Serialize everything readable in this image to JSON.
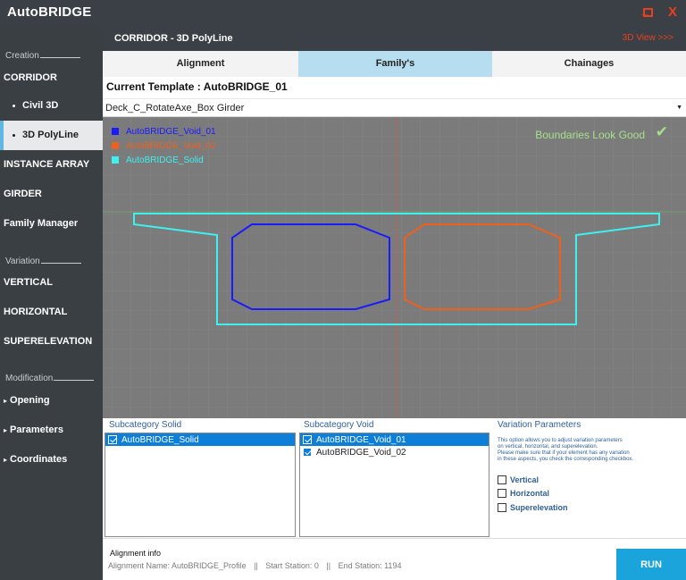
{
  "app": {
    "title": "AutoBRIDGE",
    "minimize_label": "_",
    "close_label": "X"
  },
  "sidebar": {
    "creation_label": "Creation",
    "corridor": "CORRIDOR",
    "civil3d": "Civil 3D",
    "polyline3d": "3D PolyLine",
    "instance_array": "INSTANCE ARRAY",
    "girder": "GIRDER",
    "family_manager": "Family Manager",
    "variation_label": "Variation",
    "vertical": "VERTICAL",
    "horizontal": "HORIZONTAL",
    "superelevation": "SUPERELEVATION",
    "modification_label": "Modification",
    "opening": "Opening",
    "parameters": "Parameters",
    "coordinates": "Coordinates"
  },
  "header": {
    "title": "CORRIDOR - 3D PolyLine",
    "view_link": "3D View >>>"
  },
  "tabs": [
    {
      "label": "Alignment",
      "active": false
    },
    {
      "label": "Family's",
      "active": true
    },
    {
      "label": "Chainages",
      "active": false
    }
  ],
  "template": {
    "label": "Current Template : ",
    "value": "AutoBRIDGE_01"
  },
  "family_select": {
    "value": "Deck_C_RotateAxe_Box Girder"
  },
  "canvas": {
    "legend": [
      {
        "name": "AutoBRIDGE_Void_01",
        "color": "#1a1aff"
      },
      {
        "name": "AutoBRIDGE_Void_02",
        "color": "#f0601c"
      },
      {
        "name": "AutoBRIDGE_Solid",
        "color": "#3ff0f0"
      }
    ],
    "status": "Boundaries Look Good",
    "status_icon": "check-icon"
  },
  "subcategory_solid": {
    "title": "Subcategory Solid",
    "items": [
      {
        "label": "AutoBRIDGE_Solid",
        "checked": true,
        "selected": true
      }
    ]
  },
  "subcategory_void": {
    "title": "Subcategory Void",
    "items": [
      {
        "label": "AutoBRIDGE_Void_01",
        "checked": true,
        "selected": true
      },
      {
        "label": "AutoBRIDGE_Void_02",
        "checked": true,
        "selected": false
      }
    ]
  },
  "variation_params": {
    "title": "Variation Parameters",
    "desc_1": "This option allows you to adjust variation parameters",
    "desc_2": "on vertical, horizontal, and superelevation.",
    "desc_3": "Please make sure that if your element has any variation",
    "desc_4": "in these aspects, you check the corresponding checkbox.",
    "options": [
      {
        "label": "Vertical",
        "checked": false
      },
      {
        "label": "Horizontal",
        "checked": false
      },
      {
        "label": "Superelevation",
        "checked": false
      }
    ]
  },
  "footer": {
    "title": "Alignment info",
    "alignment_name": "Alignment Name: AutoBRIDGE_Profile",
    "start_station": "Start Station: 0",
    "end_station": "End Station: 1194",
    "separator": "||",
    "run_label": "RUN"
  }
}
